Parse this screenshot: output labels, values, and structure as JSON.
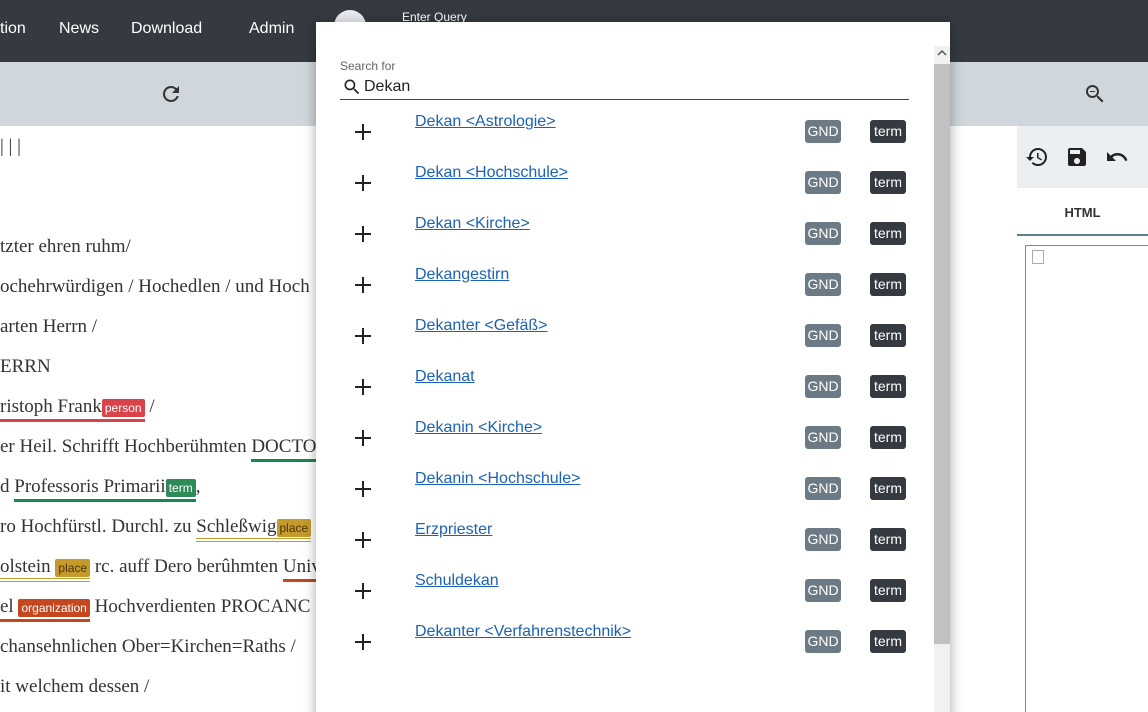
{
  "nav": {
    "items": [
      "tion",
      "News",
      "Download",
      "Admin"
    ]
  },
  "dialog": {
    "title": "Enter Query",
    "search_label": "Search for",
    "search_value": "Dekan",
    "results": [
      {
        "label": "Dekan <Astrologie>",
        "source": "GND",
        "type": "term"
      },
      {
        "label": "Dekan <Hochschule>",
        "source": "GND",
        "type": "term"
      },
      {
        "label": "Dekan <Kirche>",
        "source": "GND",
        "type": "term"
      },
      {
        "label": "Dekangestirn",
        "source": "GND",
        "type": "term"
      },
      {
        "label": "Dekanter <Gefäß>",
        "source": "GND",
        "type": "term"
      },
      {
        "label": "Dekanat",
        "source": "GND",
        "type": "term"
      },
      {
        "label": "Dekanin <Kirche>",
        "source": "GND",
        "type": "term"
      },
      {
        "label": "Dekanin <Hochschule>",
        "source": "GND",
        "type": "term"
      },
      {
        "label": "Erzpriester",
        "source": "GND",
        "type": "term"
      },
      {
        "label": "Schuldekan",
        "source": "GND",
        "type": "term"
      },
      {
        "label": "Dekanter <Verfahrenstechnik>",
        "source": "GND",
        "type": "term"
      }
    ]
  },
  "document": {
    "line0": "| | |",
    "line1": "tzter ehren ruhm/",
    "line2": "ochehrwürdigen / Hochedlen / und Hoch",
    "line3": "arten Herrn /",
    "line4": "ERRN",
    "line5_text": "ristoph Frank",
    "line5_tag": "person",
    "line5_after": " /",
    "line6_pre": "er Heil. Schrifft Hochberühmten ",
    "line6_ent": "DOCTO",
    "line7_pre": "d ",
    "line7_ent": "Professoris Primarii",
    "line7_tag": "term",
    "line7_after": ",",
    "line8_pre": "ro Hochfürstl. Durchl. zu ",
    "line8_ent": "Schleßwig",
    "line8_tag": "place",
    "line9_ent": "olstein",
    "line9_tag": "place",
    "line9_after": " rc. auff Dero berûhmten ",
    "line9_ent2": "Univ",
    "line10_ent": "el",
    "line10_tag": "organization",
    "line10_after": " Hochverdienten PROCANC",
    "line11": "chansehnlichen Ober=Kirchen=Raths /",
    "line12": "it welchem dessen /"
  },
  "right_panel": {
    "tab_label": "HTML"
  },
  "colors": {
    "nav_bg": "#343a40",
    "toolbar_bg": "#cfd7dc",
    "link": "#1a63b8",
    "badge_gnd": "#6c7a86",
    "badge_term": "#343a40",
    "tag_person": "#d9434a",
    "tag_term": "#2e8b57",
    "tag_place": "#c49a2b",
    "tag_org": "#c5471f"
  }
}
